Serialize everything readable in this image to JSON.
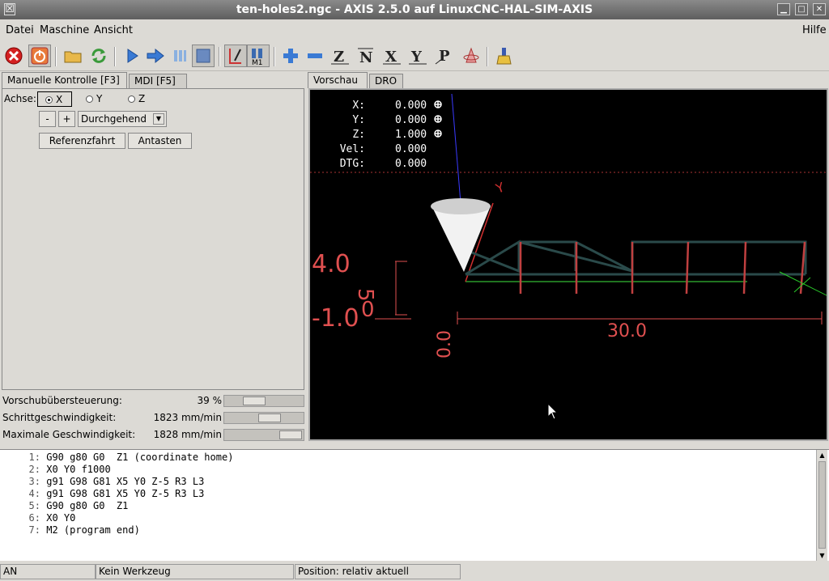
{
  "window": {
    "title": "ten-holes2.ngc - AXIS 2.5.0 auf  LinuxCNC-HAL-SIM-AXIS"
  },
  "menu": {
    "items": [
      "Datei",
      "Maschine",
      "Ansicht"
    ],
    "help": "Hilfe"
  },
  "toolbar": {
    "icons": [
      "estop-icon",
      "power-icon",
      "open-file-icon",
      "reload-icon",
      "run-icon",
      "step-icon",
      "pause-icon",
      "stop-icon",
      "block-delete-icon",
      "optional-stop-icon",
      "zoom-in-icon",
      "zoom-out-icon",
      "view-z-icon",
      "view-z2-icon",
      "view-x-icon",
      "view-y-icon",
      "view-p-icon",
      "rotate-icon",
      "clear-plot-icon"
    ]
  },
  "left_tabs": [
    "Manuelle Kontrolle [F3]",
    "MDI [F5]"
  ],
  "manual": {
    "axis_label": "Achse:",
    "axes": [
      "X",
      "Y",
      "Z"
    ],
    "selected_axis": "X",
    "minus": "-",
    "plus": "+",
    "jog_mode": "Durchgehend",
    "home_button": "Referenzfahrt",
    "touch_button": "Antasten"
  },
  "overrides": {
    "feed": {
      "label": "Vorschubübersteuerung:",
      "value": "39 %",
      "level": 0.39
    },
    "jog": {
      "label": "Schrittgeschwindigkeit:",
      "value": "1823 mm/min",
      "level": 0.55
    },
    "max": {
      "label": "Maximale Geschwindigkeit:",
      "value": "1828 mm/min",
      "level": 1.0
    }
  },
  "right_tabs": [
    "Vorschau",
    "DRO"
  ],
  "dro": {
    "rows": [
      {
        "label": "X:",
        "value": "0.000"
      },
      {
        "label": "Y:",
        "value": "0.000"
      },
      {
        "label": "Z:",
        "value": "1.000"
      },
      {
        "label": "Vel:",
        "value": "0.000"
      },
      {
        "label": "DTG:",
        "value": "0.000"
      }
    ]
  },
  "preview_labels": {
    "dim_x": "30.0",
    "dim_z1": "4.0",
    "dim_z2": "-1.0",
    "dim_z3": "5",
    "dim_z4": "0",
    "dim_y": "0.0",
    "axis_y": "Y"
  },
  "gcode": [
    {
      "num": "1:",
      "text": "G90 g80 G0  Z1 (coordinate home)"
    },
    {
      "num": "2:",
      "text": "X0 Y0 f1000"
    },
    {
      "num": "3:",
      "text": "g91 G98 G81 X5 Y0 Z-5 R3 L3"
    },
    {
      "num": "4:",
      "text": "g91 G98 G81 X5 Y0 Z-5 R3 L3"
    },
    {
      "num": "5:",
      "text": "G90 g80 G0  Z1"
    },
    {
      "num": "6:",
      "text": "X0 Y0"
    },
    {
      "num": "7:",
      "text": "M2 (program end)"
    }
  ],
  "status": {
    "machine": "AN",
    "tool": "Kein Werkzeug",
    "position": "Position: relativ aktuell"
  }
}
